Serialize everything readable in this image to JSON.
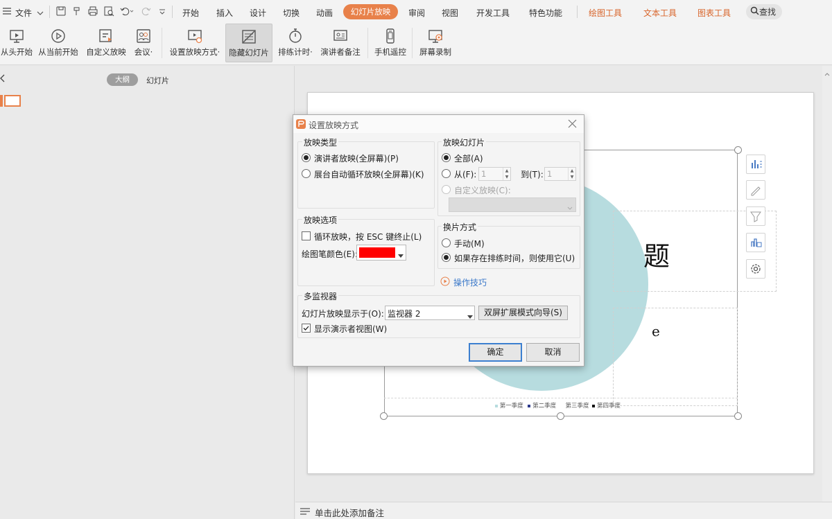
{
  "menu": {
    "file": "文件",
    "tabs": [
      "开始",
      "插入",
      "设计",
      "切换",
      "动画"
    ],
    "active_tab": "幻灯片放映",
    "tabs_after": [
      "审阅",
      "视图",
      "开发工具",
      "特色功能"
    ],
    "context_tabs": [
      "绘图工具",
      "文本工具",
      "图表工具"
    ],
    "search": "查找"
  },
  "ribbon": {
    "from_start": "从头开始",
    "from_current": "从当前开始",
    "custom_show": "自定义放映",
    "meeting": "会议·",
    "setup_show": "设置放映方式·",
    "hide_slide": "隐藏幻灯片",
    "rehearse": "排练计时·",
    "presenter_notes": "演讲者备注",
    "phone_remote": "手机遥控",
    "screen_record": "屏幕录制"
  },
  "left_panel": {
    "tab_outline": "大纲",
    "tab_slides": "幻灯片"
  },
  "notes_bar": {
    "placeholder": "单击此处添加备注"
  },
  "slide": {
    "title_fragment": "题",
    "text_fragment": "e",
    "legend": [
      "第一季度",
      "第二季度",
      "第三季度",
      "第四季度"
    ]
  },
  "dialog": {
    "title": "设置放映方式",
    "show_type": {
      "title": "放映类型",
      "option_presenter": "演讲者放映(全屏幕)(P)",
      "option_kiosk": "展台自动循环放映(全屏幕)(K)"
    },
    "show_slides": {
      "title": "放映幻灯片",
      "all": "全部(A)",
      "from": "从(F):",
      "from_value": "1",
      "to": "到(T):",
      "to_value": "1",
      "custom": "自定义放映(C):"
    },
    "show_options": {
      "title": "放映选项",
      "loop": "循环放映，按 ESC 键终止(L)",
      "pen_color_label": "绘图笔颜色(E):",
      "pen_color": "#ff0000"
    },
    "advance": {
      "title": "换片方式",
      "manual": "手动(M)",
      "use_timings": "如果存在排练时间，则使用它(U)"
    },
    "tips_link": "操作技巧",
    "monitors": {
      "title": "多监视器",
      "display_on_label": "幻灯片放映显示于(O):",
      "display_on_value": "监视器 2",
      "dual_screen_wizard": "双屏扩展模式向导(S)",
      "presenter_view": "显示演示者视图(W)"
    },
    "ok": "确定",
    "cancel": "取消"
  },
  "colors": {
    "accent": "#e8814a",
    "pie_light": "#b7dcdf",
    "pie_dark": "#2e3a8c",
    "link": "#3a78c9"
  }
}
